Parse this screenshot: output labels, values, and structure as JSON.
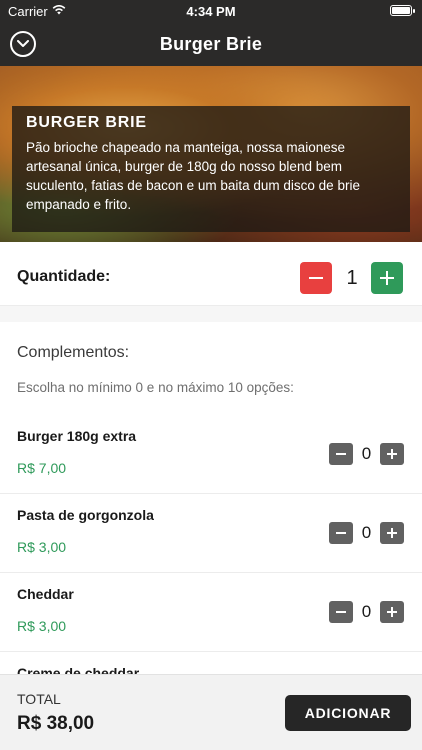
{
  "status_bar": {
    "carrier": "Carrier",
    "time": "4:34 PM"
  },
  "nav": {
    "title": "Burger Brie"
  },
  "product": {
    "name": "BURGER BRIE",
    "description": "Pão brioche chapeado na manteiga, nossa maionese artesanal única, burger de 180g do nosso blend bem suculento, fatias de bacon e um baita dum disco de brie empanado e frito."
  },
  "quantity": {
    "label": "Quantidade:",
    "value": "1"
  },
  "complements": {
    "title": "Complementos:",
    "subtitle": "Escolha no mínimo 0 e no máximo 10 opções:",
    "items": [
      {
        "name": "Burger 180g extra",
        "price": "R$ 7,00",
        "count": "0"
      },
      {
        "name": "Pasta de gorgonzola",
        "price": "R$ 3,00",
        "count": "0"
      },
      {
        "name": "Cheddar",
        "price": "R$ 3,00",
        "count": "0"
      },
      {
        "name": "Creme de cheddar",
        "price": "",
        "count": ""
      }
    ]
  },
  "footer": {
    "total_label": "TOTAL",
    "total_value": "R$ 38,00",
    "add_label": "ADICIONAR"
  },
  "colors": {
    "accent_green": "#2f9a5a",
    "minus_red": "#e8403f",
    "header_dark": "#2b2a29"
  }
}
